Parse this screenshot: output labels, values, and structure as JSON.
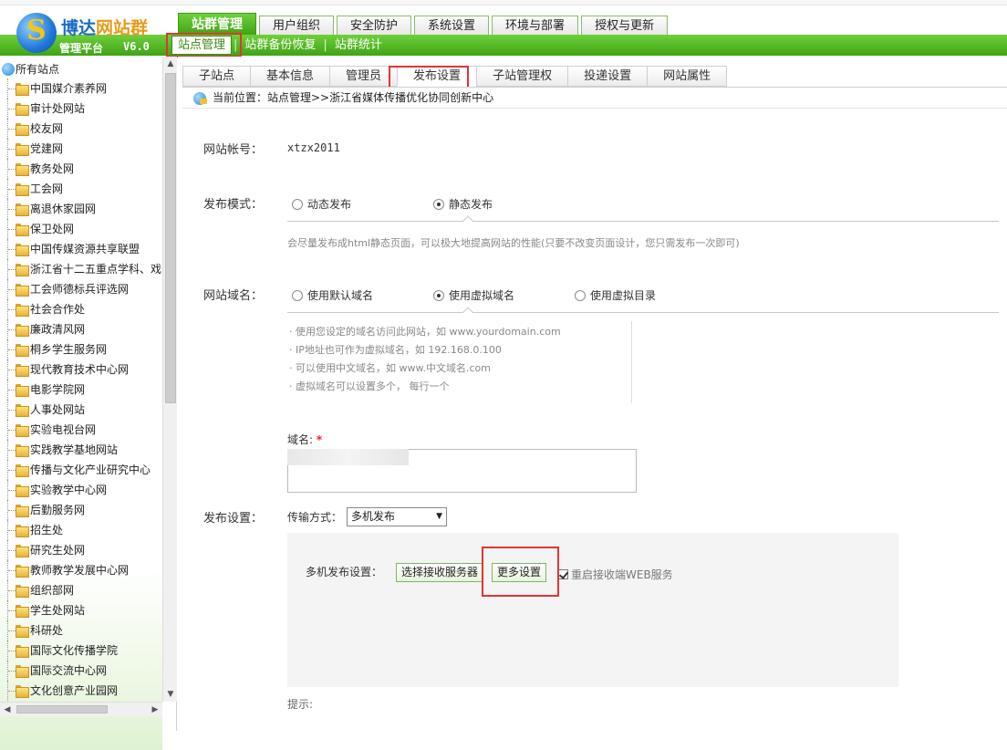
{
  "header": {
    "logo_brand_main": "博达",
    "logo_brand_site": "网站群",
    "logo_subtitle": "管理平台",
    "logo_version": "V6.0",
    "main_tabs": [
      {
        "label": "站群管理",
        "active": true
      },
      {
        "label": "用户组织",
        "active": false
      },
      {
        "label": "安全防护",
        "active": false
      },
      {
        "label": "系统设置",
        "active": false
      },
      {
        "label": "环境与部署",
        "active": false
      },
      {
        "label": "授权与更新",
        "active": false
      }
    ],
    "sub_nav": [
      {
        "label": "站点管理",
        "active": true
      },
      {
        "label": "站群备份恢复",
        "active": false
      },
      {
        "label": "站群统计",
        "active": false
      }
    ],
    "sub_sep": "|",
    "accent_green": "#3fa315",
    "highlight_red": "#e33333"
  },
  "sidebar": {
    "root_label": "所有站点",
    "items": [
      "中国媒介素养网",
      "审计处网站",
      "校友网",
      "党建网",
      "教务处网",
      "工会网",
      "离退休家园网",
      "保卫处网",
      "中国传媒资源共享联盟",
      "浙江省十二五重点学科、戏",
      "工会师德标兵评选网",
      "社会合作处",
      "廉政清风网",
      "桐乡学生服务网",
      "现代教育技术中心网",
      "电影学院网",
      "人事处网站",
      "实验电视台网",
      "实践教学基地网站",
      "传播与文化产业研究中心",
      "实验教学中心网",
      "后勤服务网",
      "招生处",
      "研究生处网",
      "教师教学发展中心网",
      "组织部网",
      "学生处网站",
      "科研处",
      "国际文化传播学院",
      "国际交流中心网",
      "文化创意产业园网"
    ],
    "scroll_up": "▲",
    "scroll_down": "▼",
    "scroll_left": "◀",
    "scroll_right": "▶"
  },
  "content": {
    "tabs": [
      {
        "label": "子站点",
        "active": false
      },
      {
        "label": "基本信息",
        "active": false
      },
      {
        "label": "管理员",
        "active": false
      },
      {
        "label": "发布设置",
        "active": true
      },
      {
        "label": "子站管理权",
        "active": false
      },
      {
        "label": "投递设置",
        "active": false
      },
      {
        "label": "网站属性",
        "active": false
      }
    ],
    "breadcrumb": "当前位置：站点管理>>浙江省媒体传播优化协同创新中心",
    "account_label": "网站帐号：",
    "account_value": "xtzx2011",
    "publish_mode_label": "发布模式：",
    "publish_mode_options": [
      {
        "label": "动态发布",
        "checked": false
      },
      {
        "label": "静态发布",
        "checked": true
      }
    ],
    "publish_mode_hint": "会尽量发布成html静态页面，可以极大地提高网站的性能(只要不改变页面设计，您只需发布一次即可)",
    "domain_label": "网站域名：",
    "domain_options": [
      {
        "label": "使用默认域名",
        "checked": false
      },
      {
        "label": "使用虚拟域名",
        "checked": true
      },
      {
        "label": "使用虚拟目录",
        "checked": false
      }
    ],
    "domain_hints": [
      "· 使用您设定的域名访问此网站，如 www.yourdomain.com",
      "· IP地址也可作为虚拟域名，如 192.168.0.100",
      "· 可以使用中文域名，如 www.中文域名.com",
      "· 虚拟域名可以设置多个， 每行一个"
    ],
    "domain_field_label": "域名:",
    "required_mark": "*",
    "publish_settings_label": "发布设置：",
    "transfer_label": "传输方式：",
    "transfer_selected": "多机发布",
    "select_arrow": "▼",
    "multi_label": "多机发布设置：",
    "choose_server_button": "选择接收服务器",
    "more_settings_button": "更多设置",
    "restart_checkbox_label": "重启接收端WEB服务",
    "restart_checked": true,
    "tip_label": "提示:"
  }
}
